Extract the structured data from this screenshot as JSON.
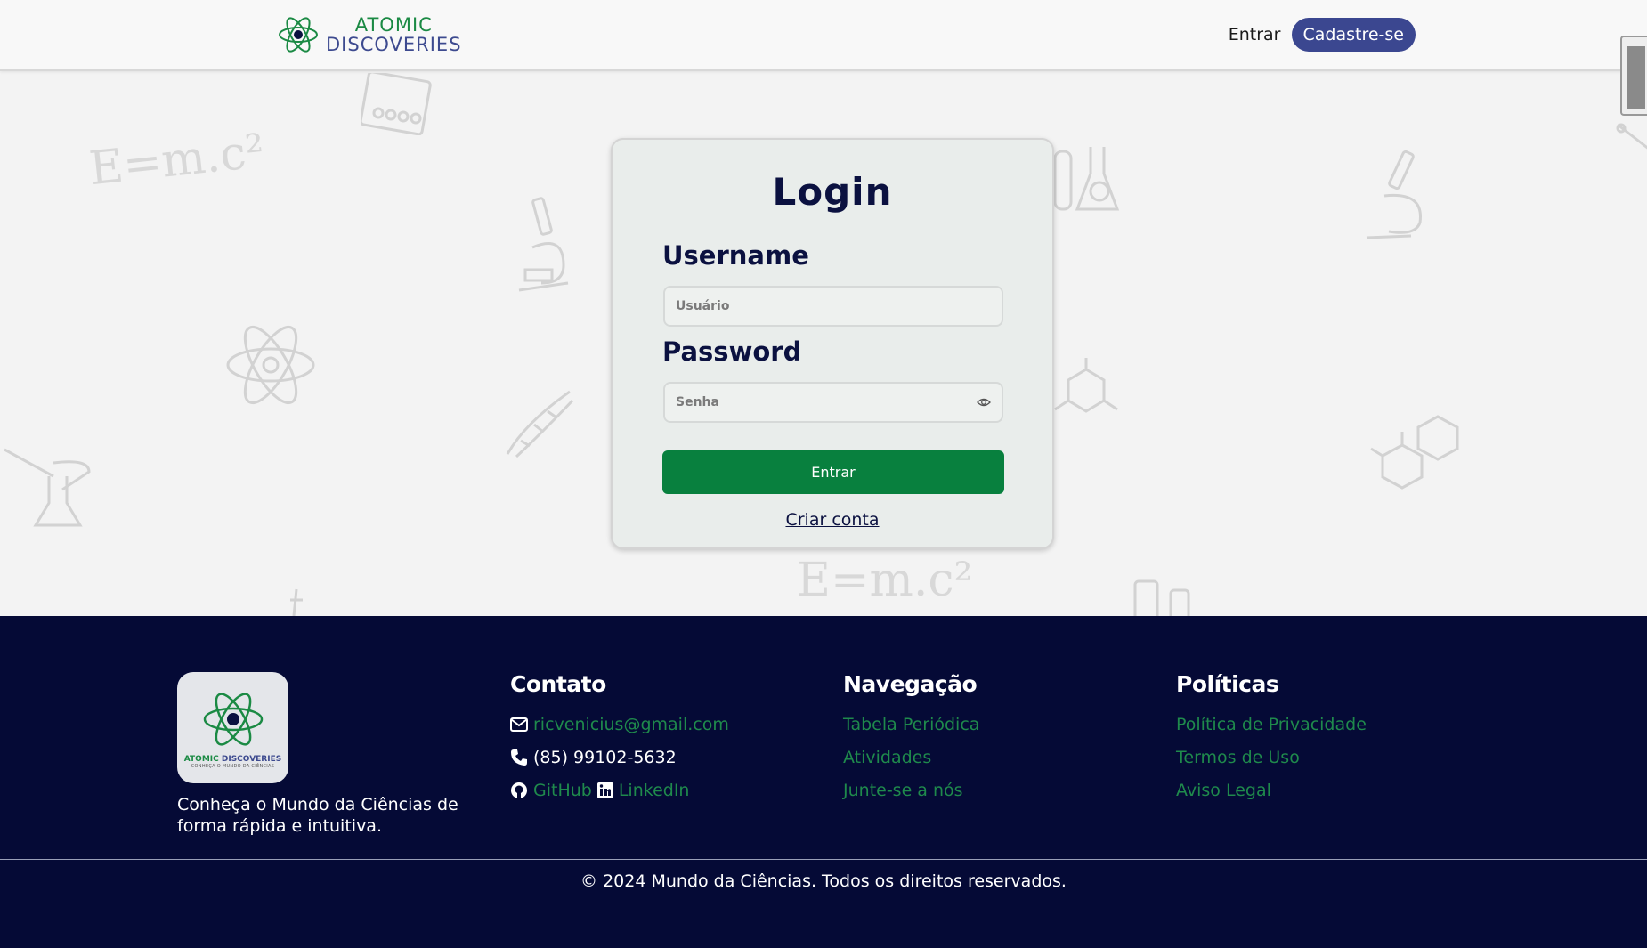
{
  "header": {
    "brand_line1": "ATOMIC",
    "brand_line2": "DISCOVERIES",
    "login_link": "Entrar",
    "signup_button": "Cadastre-se"
  },
  "doodles": {
    "formula": "E=m.c²"
  },
  "login": {
    "title": "Login",
    "username_label": "Username",
    "username_placeholder": "Usuário",
    "password_label": "Password",
    "password_placeholder": "Senha",
    "submit_label": "Entrar",
    "create_account": "Criar conta"
  },
  "footer": {
    "logo_line1": "ATOMIC",
    "logo_line2": "DISCOVERIES",
    "logo_sub": "CONHEÇA O MUNDO DA CIÊNCIAS",
    "description": "Conheça o Mundo da Ciências de forma rápida e intuitiva.",
    "contact": {
      "heading": "Contato",
      "email": "ricvenicius@gmail.com",
      "phone": "(85) 99102-5632",
      "github": "GitHub",
      "linkedin": "LinkedIn"
    },
    "navigation": {
      "heading": "Navegação",
      "items": [
        "Tabela Periódica",
        "Atividades",
        "Junte-se a nós"
      ]
    },
    "policies": {
      "heading": "Políticas",
      "items": [
        "Política de Privacidade",
        "Termos de Uso",
        "Aviso Legal"
      ]
    },
    "copyright": "© 2024 Mundo da Ciências. Todos os direitos reservados."
  },
  "colors": {
    "brand_green": "#08803e",
    "brand_blue": "#3b4790",
    "footer_bg": "#050a36",
    "link_green": "#1f8a4c"
  }
}
